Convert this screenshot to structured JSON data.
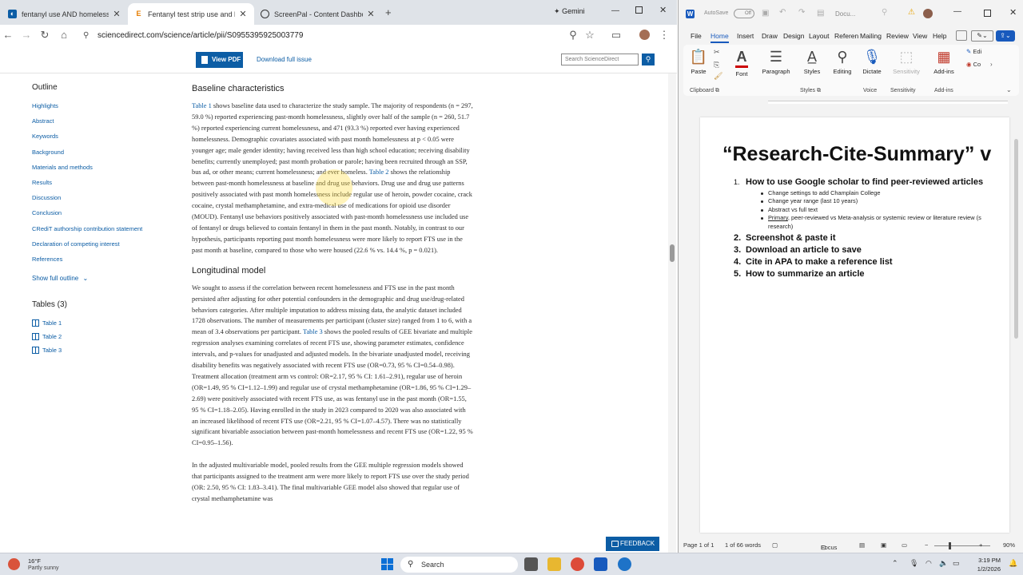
{
  "browser": {
    "tabs": [
      {
        "title": "fentanyl use AND homelessness",
        "active": false
      },
      {
        "title": "Fentanyl test strip use and hom",
        "active": true
      },
      {
        "title": "ScreenPal - Content Dashboard",
        "active": false
      }
    ],
    "gemini_label": "Gemini",
    "url": "sciencedirect.com/science/article/pii/S0955395925003779"
  },
  "sd": {
    "view_pdf": "View PDF",
    "download_issue": "Download full issue",
    "search_placeholder": "Search ScienceDirect",
    "outline_title": "Outline",
    "outline_items": [
      "Highlights",
      "Abstract",
      "Keywords",
      "Background",
      "Materials and methods",
      "Results",
      "Discussion",
      "Conclusion",
      "CRediT authorship contribution statement",
      "Declaration of competing interest",
      "References"
    ],
    "show_full_outline": "Show full outline",
    "tables_title": "Tables (3)",
    "tables": [
      "Table 1",
      "Table 2",
      "Table 3"
    ],
    "feedback": "FEEDBACK"
  },
  "article": {
    "h1": "Baseline characteristics",
    "p1_link1": "Table 1",
    "p1_a": " shows baseline data used to characterize the study sample. The majority of respondents (n = 297, 59.0 %) reported experiencing past-month homelessness, slightly over half of the sample (n = 260, 51.7 %) reported experiencing current homelessness, and 471 (93.3 %) reported ever having experienced homelessness. Demographic covariates associated with past month homelessness at p < 0.05 were younger age; male gender identity; having received less than high school education; receiving disability benefits; currently unemployed; past month probation or parole; having been recruited through an SSP, bus ad, or other means; current homelessness; and ever homeless. ",
    "p1_link2": "Table 2",
    "p1_b": " shows the relationship between past-month homelessness at baseline and drug use behaviors. Drug use and drug use patterns positively associated with past month homelessness include regular use of heroin, powder cocaine, crack cocaine, crystal methamphetamine, and extra-medical use of medications for opioid use disorder (MOUD). Fentanyl use behaviors positively associated with past-month homelessness use included use of fentanyl or drugs believed to contain fentanyl in them in the past month. Notably, in contrast to our hypothesis, participants reporting past month homelessness were more likely to report FTS use in the past month at baseline, compared to those who were housed (22.6 % vs. 14.4 %, p = 0.021).",
    "h2": "Longitudinal model",
    "p2_a": "We sought to assess if the correlation between recent homelessness and FTS use in the past month persisted after adjusting for other potential confounders in the demographic and drug use/drug-related behaviors categories. After multiple imputation to address missing data, the analytic dataset included 1728 observations. The number of measurements per participant (cluster size) ranged from 1 to 6, with a mean of 3.4 observations per participant. ",
    "p2_link": "Table 3",
    "p2_b": " shows the pooled results of GEE bivariate and multiple regression analyses examining correlates of recent FTS use, showing parameter estimates, confidence intervals, and p-values for unadjusted and adjusted models. In the bivariate unadjusted model, receiving disability benefits was negatively associated with recent FTS use (OR=0.73, 95 % CI=0.54–0.98). Treatment allocation (treatment arm vs control: OR=2.17, 95 % CI: 1.61–2.91), regular use of heroin (OR=1.49, 95 % CI=1.12–1.99) and regular use of crystal methamphetamine (OR=1.86, 95 % CI=1.29–2.69) were positively associated with recent FTS use, as was fentanyl use in the past month (OR=1.55, 95 % CI=1.18–2.05). Having enrolled in the study in 2023 compared to 2020 was also associated with an increased likelihood of recent FTS use (OR=2.21, 95 % CI=1.07–4.57). There was no statistically significant bivariable association between past-month homelessness and recent FTS use (OR=1.22, 95 % CI=0.95–1.56).",
    "p3": "In the adjusted multivariable model, pooled results from the GEE multiple regression models showed that participants assigned to the treatment arm were more likely to report FTS use over the study period (OR: 2.50, 95 % CI: 1.83–3.41). The final multivariable GEE model also showed that regular use of crystal methamphetamine was"
  },
  "word": {
    "autosave": "AutoSave",
    "toggle": "Off",
    "doc_name": "Docu...",
    "menu": [
      "File",
      "Home",
      "Insert",
      "Draw",
      "Design",
      "Layout",
      "Referen",
      "Mailing",
      "Review",
      "View",
      "Help"
    ],
    "ribbon": {
      "paste": "Paste",
      "font": "Font",
      "paragraph": "Paragraph",
      "styles": "Styles",
      "editing": "Editing",
      "dictate": "Dictate",
      "sensitivity": "Sensitivity",
      "addins": "Add-ins",
      "edit_short": "Edi",
      "co_short": "Co",
      "groups": [
        "Clipboard",
        "Styles",
        "Voice",
        "Sensitivity",
        "Add-ins"
      ]
    },
    "doc": {
      "title": "“Research-Cite-Summary” v",
      "item1_num": "1.",
      "item1": "How to use Google scholar to find peer-reviewed articles",
      "sub": [
        "Change settings to add Champlain College",
        "Change year range (last 10 years)",
        "Abstract vs full text"
      ],
      "sub_primary_u": "Primary",
      "sub_primary_rest": ", peer-reviewed vs Meta-analysis or systemic review or literature review (s",
      "sub_primary_cont": "research)",
      "items": [
        {
          "num": "2.",
          "text": "Screenshot & paste it"
        },
        {
          "num": "3.",
          "text": "Download an article to save"
        },
        {
          "num": "4.",
          "text": "Cite in APA to make a reference list"
        },
        {
          "num": "5.",
          "text": "How to summarize an article"
        }
      ]
    },
    "status": {
      "page": "Page 1 of 1",
      "words": "1 of 66 words",
      "focus": "Focus",
      "zoom": "90%"
    }
  },
  "taskbar": {
    "temp": "16°F",
    "weather": "Partly sunny",
    "search": "Search",
    "time": "3:19 PM",
    "date": "1/2/2026"
  }
}
